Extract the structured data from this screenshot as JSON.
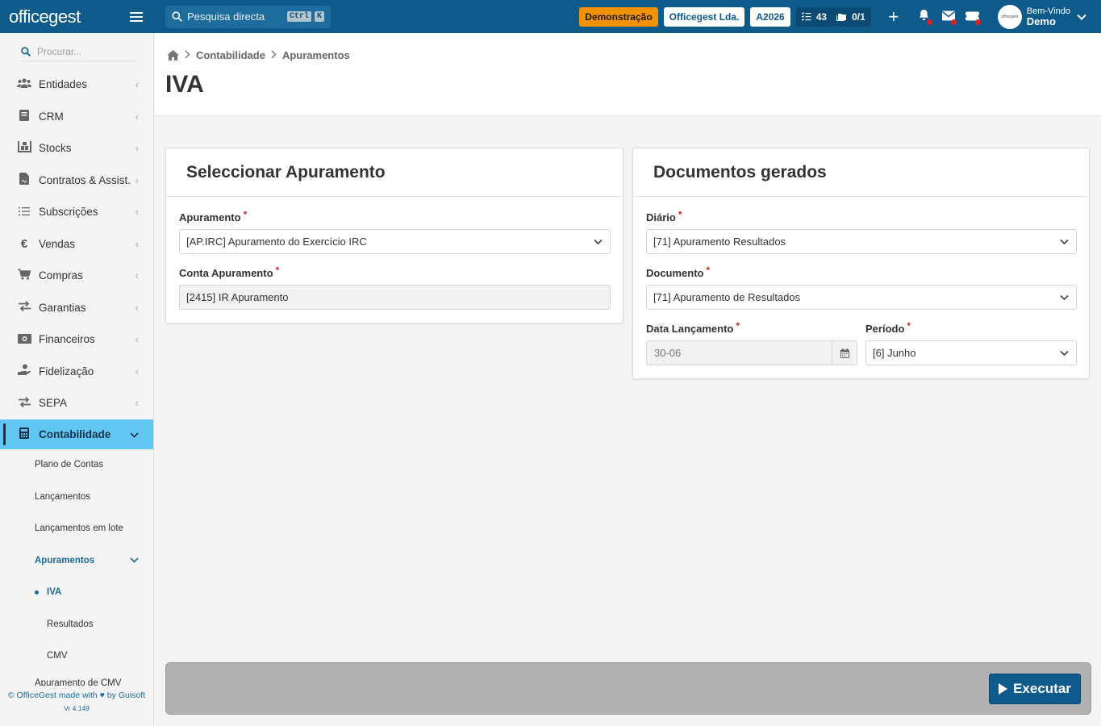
{
  "topbar": {
    "logo": "officegest",
    "search_placeholder": "Pesquisa directa",
    "search_kbd_1": "Ctrl",
    "search_kbd_2": "K",
    "demo_label": "Demonstração",
    "company_label": "Officegest Lda.",
    "year_label": "A2026",
    "tasks_count": "43",
    "docs_count": "0/1",
    "welcome": "Bem-Vindo",
    "user_name": "Demo",
    "avatar_text": "officegest"
  },
  "sidebar": {
    "search_placeholder": "Procurar...",
    "items": [
      {
        "label": "Entidades",
        "icon": "users-icon"
      },
      {
        "label": "CRM",
        "icon": "book-icon"
      },
      {
        "label": "Stocks",
        "icon": "warehouse-icon"
      },
      {
        "label": "Contratos & Assist.",
        "icon": "contract-icon"
      },
      {
        "label": "Subscrições",
        "icon": "list-icon"
      },
      {
        "label": "Vendas",
        "icon": "euro-icon"
      },
      {
        "label": "Compras",
        "icon": "cart-icon"
      },
      {
        "label": "Garantias",
        "icon": "exchange-icon"
      },
      {
        "label": "Financeiros",
        "icon": "money-icon"
      },
      {
        "label": "Fidelização",
        "icon": "hand-coin-icon"
      },
      {
        "label": "SEPA",
        "icon": "exchange-icon"
      },
      {
        "label": "Contabilidade",
        "icon": "calculator-icon"
      }
    ],
    "sub_items": {
      "plano": "Plano de Contas",
      "lancamentos": "Lançamentos",
      "lancamentos_lote": "Lançamentos em lote",
      "apuramentos": "Apuramentos",
      "iva": "IVA",
      "resultados": "Resultados",
      "cmv": "CMV",
      "apuramento_cmv": "Apuramento de CMV"
    },
    "footer_line1": "© OfficeGest made with ♥ by Guisoft",
    "footer_line2": "Vr 4.149"
  },
  "breadcrumb": {
    "level1": "Contabilidade",
    "level2": "Apuramentos"
  },
  "page_title": "IVA",
  "card_left": {
    "title": "Seleccionar Apuramento",
    "apuramento_label": "Apuramento",
    "apuramento_value": "[AP.IRC] Apuramento do Exercício IRC",
    "conta_label": "Conta Apuramento",
    "conta_value": "[2415] IR Apuramento"
  },
  "card_right": {
    "title": "Documentos gerados",
    "diario_label": "Diário",
    "diario_value": "[71] Apuramento Resultados",
    "documento_label": "Documento",
    "documento_value": "[71] Apuramento de Resultados",
    "data_label": "Data Lançamento",
    "data_value": "30-06",
    "periodo_label": "Período",
    "periodo_value": "[6] Junho"
  },
  "action_bar": {
    "execute_label": "Executar"
  },
  "colors": {
    "primary": "#0e5a8a",
    "active_menu": "#62c6f2",
    "demo_badge": "#f39200",
    "required": "#c62828"
  }
}
